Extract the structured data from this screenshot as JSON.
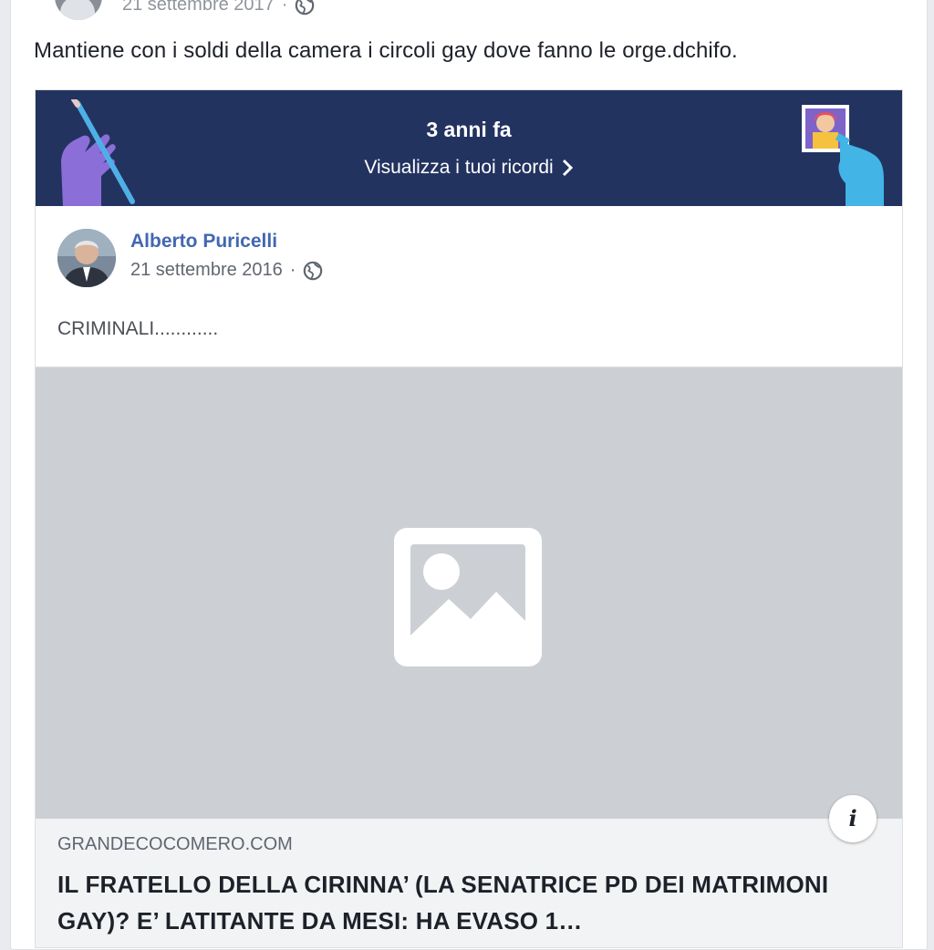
{
  "post": {
    "date": "21 settembre 2017",
    "separator": "·",
    "text": "Mantiene con i soldi della camera i circoli gay dove fanno le orge.dchifo."
  },
  "memory": {
    "title": "3 anni fa",
    "link_label": "Visualizza i tuoi ricordi",
    "background_color": "#233360"
  },
  "shared_post": {
    "author": "Alberto Puricelli",
    "date": "21 settembre 2016",
    "separator": "·",
    "text": "CRIMINALI............"
  },
  "link_preview": {
    "domain": "GRANDECOCOMERO.COM",
    "title": "IL FRATELLO DELLA CIRINNA’ (LA SENATRICE PD DEI MATRIMONI GAY)? E’ LATITANTE DA MESI: HA EVASO 1…",
    "info_icon_label": "i"
  },
  "icons": {
    "privacy": "globe-icon",
    "chevron": "chevron-right-icon",
    "placeholder": "image-placeholder-icon",
    "info": "info-icon"
  }
}
